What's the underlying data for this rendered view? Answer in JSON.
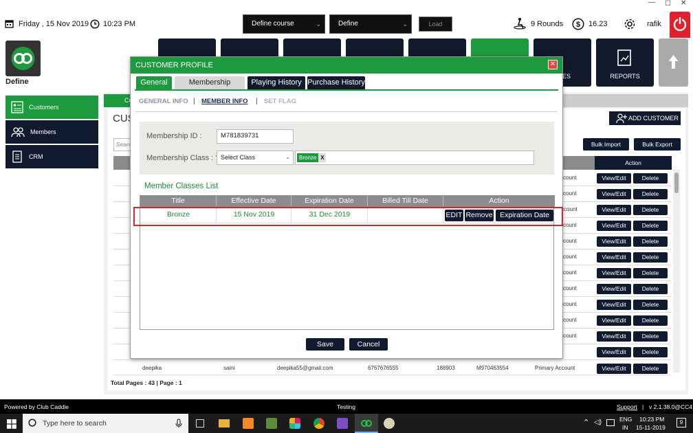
{
  "header": {
    "date": "Friday ,  15 Nov 2019",
    "time": "10:23 PM",
    "course_select": "Define  course",
    "define_select": "Define",
    "load_button": "Load",
    "rounds": "9 Rounds",
    "balance": "16.23",
    "user": "rafik"
  },
  "brand": {
    "name": "Define"
  },
  "nav": {
    "tiles": [
      "",
      "",
      "",
      "",
      "",
      "",
      "ES",
      "REPORTS"
    ]
  },
  "sidebar": {
    "items": [
      {
        "label": "Customers"
      },
      {
        "label": "Members"
      },
      {
        "label": "CRM"
      }
    ]
  },
  "page": {
    "tab_partial": "Cu",
    "title_partial": "CUS",
    "search_placeholder": "Searc",
    "add_customer": "ADD CUSTOMER",
    "bulk_import": "Bulk Import",
    "bulk_export": "Bulk Export",
    "action_header": "Action",
    "view_edit": "View/Edit",
    "delete": "Delete",
    "row_types": [
      "count",
      "count",
      "ccount",
      "count",
      "count",
      "count",
      "count",
      "count",
      "count",
      "count",
      "count",
      ""
    ],
    "last_row": {
      "name": "deepika",
      "last": "saini",
      "email": "deepika55@gmail.com",
      "phone": "6767676555",
      "zip": "188903",
      "member_id": "M970463554",
      "type": "Primary Account"
    },
    "pager": "Total Pages : 43 | Page : 1"
  },
  "modal": {
    "title": "CUSTOMER PROFILE",
    "tabs": [
      "General",
      "Membership",
      "Playing History",
      "Purchase History"
    ],
    "subtabs": [
      "GENERAL INFO",
      "MEMBER INFO",
      "SET FLAG"
    ],
    "membership_id_label": "Membership ID :",
    "membership_id_value": "M781839731",
    "membership_class_label": "Membership Class : ?",
    "membership_class_select": "Select Class",
    "selected_class_tag": "Bronze",
    "tag_remove": "X",
    "classes_list_title": "Member Classes List",
    "columns": [
      "Title",
      "Effective Date",
      "Expiration Date",
      "Billed Till Date",
      "Action"
    ],
    "rows": [
      {
        "title": "Bronze",
        "effective": "15 Nov 2019",
        "expiration": "31 Dec 2019",
        "billed": "",
        "edit": "EDIT",
        "remove": "Remove",
        "exp_date": "Expiration Date"
      }
    ],
    "save": "Save",
    "cancel": "Cancel"
  },
  "status_bar": {
    "left": "Powered by Club Caddie",
    "center": "Testing",
    "support": "Support",
    "version": "v 2.1.38.0@CC4"
  },
  "taskbar": {
    "search_placeholder": "Type here to search",
    "lang": "ENG",
    "region": "IN",
    "time": "10:23 PM",
    "date": "15-11-2019",
    "notifications": "9"
  },
  "colors": {
    "accent": "#1d9a3e",
    "dark": "#0f1a2e",
    "highlight": "#e0202a"
  }
}
